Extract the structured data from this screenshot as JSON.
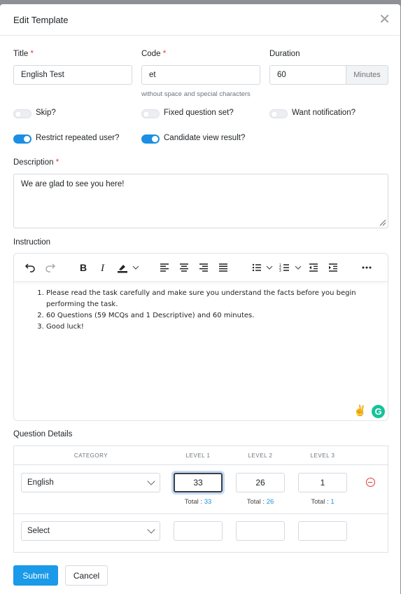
{
  "modal": {
    "title": "Edit Template"
  },
  "fields": {
    "title": {
      "label": "Title",
      "value": "English Test"
    },
    "code": {
      "label": "Code",
      "value": "et",
      "hint": "without space and special characters"
    },
    "duration": {
      "label": "Duration",
      "value": "60",
      "unit": "Minutes"
    },
    "required_mark": "*"
  },
  "toggles": [
    {
      "label": "Skip?",
      "on": false
    },
    {
      "label": "Fixed question set?",
      "on": false
    },
    {
      "label": "Want notification?",
      "on": false
    },
    {
      "label": "Restrict repeated user?",
      "on": true
    },
    {
      "label": "Candidate view result?",
      "on": true
    }
  ],
  "description": {
    "label": "Description",
    "value": "We are glad to see you here!"
  },
  "instruction": {
    "label": "Instruction",
    "items": [
      "Please read the task carefully and make sure you understand the facts before you begin performing the task.",
      "60 Questions (59 MCQs and 1 Descriptive) and 60 minutes.",
      "Good luck!"
    ]
  },
  "questions": {
    "label": "Question Details",
    "headers": [
      "CATEGORY",
      "LEVEL 1",
      "LEVEL 2",
      "LEVEL 3"
    ],
    "rows": [
      {
        "category": "English",
        "l1": "33",
        "l2": "26",
        "l3": "1",
        "t1": "33",
        "t2": "26",
        "t3": "1"
      },
      {
        "category": "Select",
        "l1": "",
        "l2": "",
        "l3": ""
      }
    ],
    "total_label": "Total :"
  },
  "actions": {
    "submit": "Submit",
    "cancel": "Cancel"
  },
  "colors": {
    "accent": "#1a9ae8",
    "danger": "#e53935",
    "grammarly": "#15c39a"
  }
}
